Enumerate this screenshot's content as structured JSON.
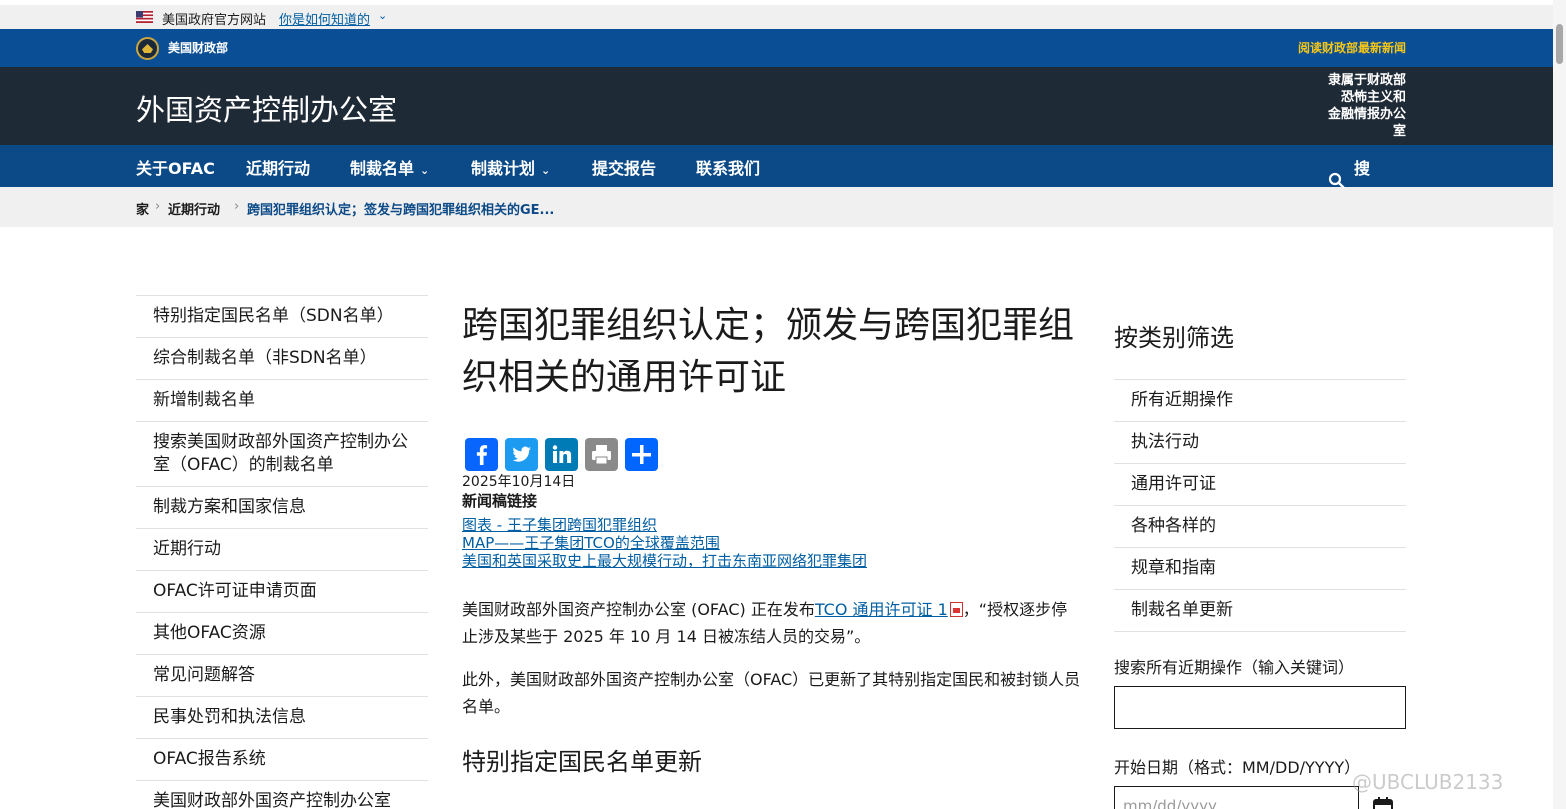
{
  "gov_banner": {
    "text": "美国政府官方网站",
    "link": "你是如何知道的",
    "chevron": "⌄"
  },
  "treasury_bar": {
    "dept": "美国财政部",
    "news_link": "阅读财政部最新新闻"
  },
  "office_header": {
    "title": "外国资产控制办公室",
    "affiliation_line1": "隶属于财政部",
    "affiliation_line2": "恐怖主义和",
    "affiliation_line3": "金融情报办公",
    "affiliation_line4": "室"
  },
  "nav": {
    "items": [
      {
        "label": "关于OFAC"
      },
      {
        "label": "近期行动"
      },
      {
        "label": "制裁名单"
      },
      {
        "label": "制裁计划"
      },
      {
        "label": "提交报告"
      },
      {
        "label": "联系我们"
      }
    ],
    "search_label": "搜索"
  },
  "breadcrumb": {
    "home": "家",
    "crumb2": "近期行动",
    "current": "跨国犯罪组织认定；签发与跨国犯罪组织相关的GE..."
  },
  "sidenav": {
    "items": [
      "特别指定国民名单（SDN名单）",
      "综合制裁名单（非SDN名单）",
      "新增制裁名单",
      "搜索美国财政部外国资产控制办公室（OFAC）的制裁名单",
      "制裁方案和国家信息",
      "近期行动",
      "OFAC许可证申请页面",
      "其他OFAC资源",
      "常见问题解答",
      "民事处罚和执法信息",
      "OFAC报告系统",
      "美国财政部外国资产控制办公室"
    ]
  },
  "content": {
    "title": "跨国犯罪组织认定；颁发与跨国犯罪组织相关的通用许可证",
    "date": "2025年10月14日",
    "press_heading": "新闻稿链接",
    "press_links": [
      "图表 - 王子集团跨国犯罪组织",
      "MAP——王子集团TCO的全球覆盖范围",
      "美国和英国采取史上最大规模行动，打击东南亚网络犯罪集团"
    ],
    "para1_before": "美国财政部外国资产控制办公室 (OFAC) 正在发布",
    "para1_link": "TCO 通用许可证 1",
    "para1_after": "，“授权逐步停止涉及某些于 2025 年 10 月 14 日被冻结人员的交易”。",
    "para2": "此外，美国财政部外国资产控制办公室（OFAC）已更新了其特别指定国民和被封锁人员名单。",
    "sub_heading": "特别指定国民名单更新"
  },
  "filter": {
    "title": "按类别筛选",
    "items": [
      "所有近期操作",
      "执法行动",
      "通用许可证",
      "各种各样的",
      "规章和指南",
      "制裁名单更新"
    ],
    "search_label": "搜索所有近期操作（输入关键词）",
    "date_label": "开始日期（格式：MM/DD/YYYY）",
    "date_placeholder": "mm/dd/yyyy"
  },
  "watermark": "@UBCLUB2133",
  "colors": {
    "treasury_blue": "#0a4f96",
    "office_dark": "#1f2a37",
    "nav_blue": "#0b4a87",
    "link_blue": "#005ea2",
    "news_yellow": "#f5c518"
  }
}
